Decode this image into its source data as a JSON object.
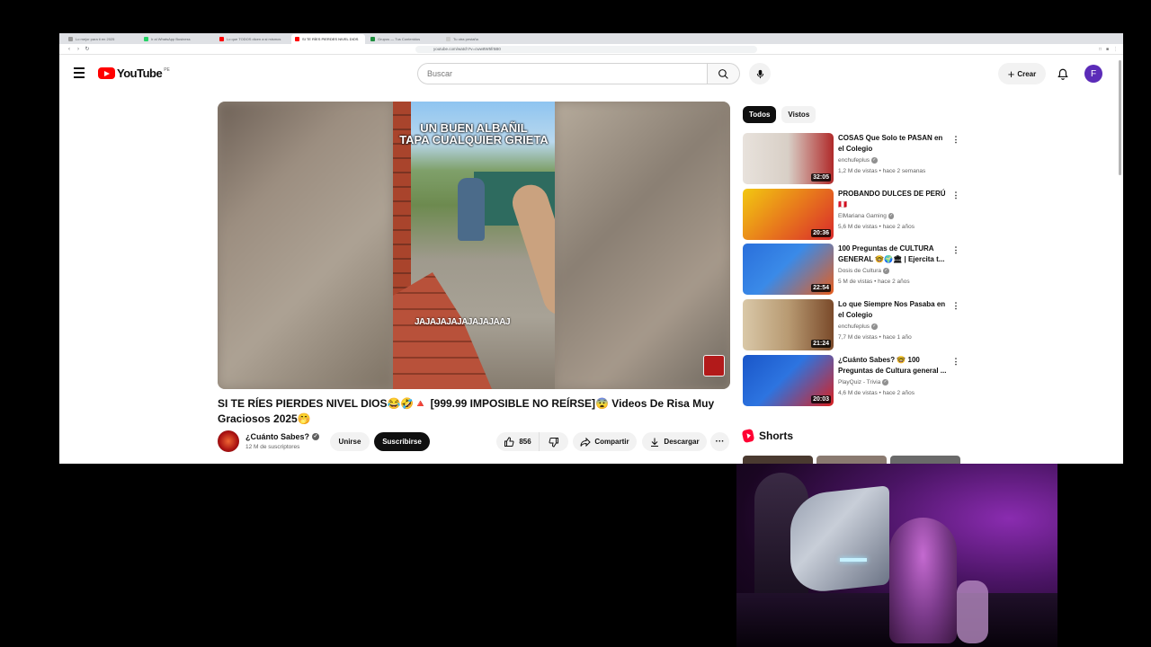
{
  "browser": {
    "tabs": [
      {
        "label": "Lo mejor para ti en 2025",
        "color": "#999999"
      },
      {
        "label": "Ir al WhatsApp Business",
        "color": "#25d366"
      },
      {
        "label": "Lo que TODOS dicen a si mismos",
        "color": "#ff0000"
      },
      {
        "label": "SI TE RÍES PIERDES NIVEL DIOS",
        "color": "#ff0000"
      },
      {
        "label": "Grupos — Tus Contenidos",
        "color": "#1e8e3e"
      },
      {
        "label": "Tu otra pestaña",
        "color": "#cccccc"
      }
    ],
    "url": "youtube.com/watch?v=cww8W5fr5B0"
  },
  "header": {
    "logo_text": "YouTube",
    "country_code": "PE",
    "search_placeholder": "Buscar",
    "create_label": "Crear",
    "avatar_letter": "F"
  },
  "video": {
    "caption_line1": "UN BUEN ALBAÑIL",
    "caption_line2": "TAPA CUALQUIER GRIETA",
    "overlay_text": "JAJAJAJAJAJAJAJAAJ",
    "title": "SI TE RÍES PIERDES NIVEL DIOS😂🤣🔺 [999.99 IMPOSIBLE NO REÍRSE]😨 Videos De Risa Muy Graciosos 2025🤭",
    "channel": "¿Cuánto Sabes?",
    "subscribers": "12 M de suscriptores",
    "join_label": "Unirse",
    "subscribe_label": "Suscribirse",
    "likes": "856",
    "share_label": "Compartir",
    "download_label": "Descargar"
  },
  "chips": [
    "Todos",
    "Vistos"
  ],
  "recommendations": [
    {
      "title": "COSAS Que Solo te PASAN en el Colegio",
      "channel": "enchufeplus",
      "meta": "1,2 M de vistas • hace 2 semanas",
      "duration": "32:05",
      "thumb_colors": [
        "#e8e2dc",
        "#b02a2a"
      ]
    },
    {
      "title": "PROBANDO DULCES DE PERÚ 🇵🇪",
      "channel": "ElMariana Gaming",
      "meta": "5,6 M de vistas • hace 2 años",
      "duration": "20:36",
      "thumb_colors": [
        "#f2c811",
        "#d92b2b"
      ]
    },
    {
      "title": "100 Preguntas de CULTURA GENERAL 🤓🌍🏛 | Ejercita t...",
      "channel": "Dosis de Cultura",
      "meta": "5 M de vistas • hace 2 años",
      "duration": "22:54",
      "thumb_colors": [
        "#2a6fdb",
        "#e85d1c"
      ]
    },
    {
      "title": "Lo que Siempre Nos Pasaba en el Colegio",
      "channel": "enchufeplus",
      "meta": "7,7 M de vistas • hace 1 año",
      "duration": "21:24",
      "thumb_colors": [
        "#d9c8a8",
        "#7a4a2a"
      ]
    },
    {
      "title": "¿Cuánto Sabes? 🤓 100 Preguntas de Cultura general ...",
      "channel": "PlayQuiz - Trivia",
      "meta": "4,6 M de vistas • hace 2 años",
      "duration": "20:03",
      "thumb_colors": [
        "#1a56c8",
        "#d92020"
      ]
    }
  ],
  "shorts_label": "Shorts"
}
